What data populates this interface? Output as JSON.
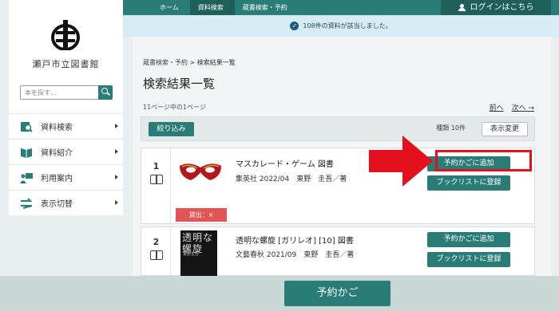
{
  "topnav": {
    "home": "ホーム",
    "materials_search": "資料検索",
    "catalog_search": "蔵書検索・予約"
  },
  "login": {
    "label": "ログインはこちら"
  },
  "notice": {
    "text": "108件の資料が該当しました。"
  },
  "sidebar": {
    "library_name": "瀬戸市立図書館",
    "search_placeholder": "本を探す…",
    "menu": [
      {
        "label": "資料検索",
        "icon": "search-book-icon"
      },
      {
        "label": "資料紹介",
        "icon": "open-book-icon"
      },
      {
        "label": "利用案内",
        "icon": "person-board-icon"
      },
      {
        "label": "表示切替",
        "icon": "switch-arrows-icon"
      }
    ]
  },
  "breadcrumb": {
    "parent": "蔵書検索・予約",
    "separator": ">",
    "current": "検索結果一覧"
  },
  "page_title": "検索結果一覧",
  "page_count": "11ページ中の1ページ",
  "pager": {
    "prev": "前へ",
    "next": "次へ →"
  },
  "toolbar": {
    "filter": "絞り込み",
    "type_count": "種類 10件",
    "display_change": "表示変更"
  },
  "results": [
    {
      "num": "1",
      "title": "マスカレード・ゲーム 図書",
      "meta": "集英社 2022/04　東野　圭吾／著",
      "add_cart": "予約かごに追加",
      "booklist": "ブックリストに登録",
      "loan_status": "貸出：×"
    },
    {
      "num": "2",
      "title": "透明な螺旋 [ガリレオ] [10] 図書",
      "meta": "文藝春秋 2021/09　東野　圭吾／著",
      "add_cart": "予約かごに追加",
      "booklist": "ブックリストに登録",
      "cover_text": "透明な螺旋",
      "cover_author": "東野圭吾"
    }
  ],
  "bottom": {
    "reserve_cart": "予約かご"
  },
  "colors": {
    "primary": "#2a7c76",
    "highlight": "#e4101d",
    "loan": "#e25555"
  }
}
